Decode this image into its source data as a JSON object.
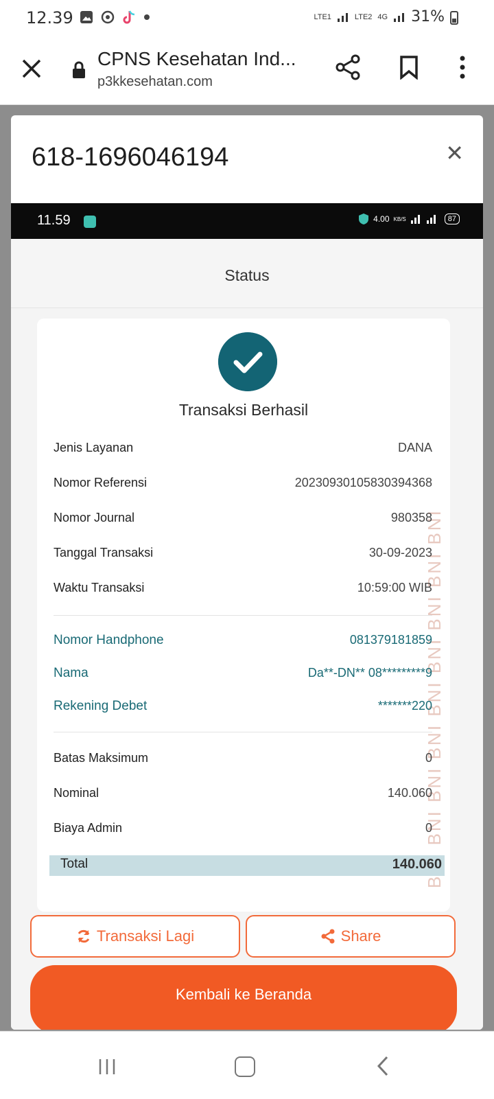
{
  "status_bar": {
    "time": "12.39",
    "battery": "31%",
    "network1": "LTE1",
    "network2": "LTE2",
    "network_type": "4G",
    "icons": [
      "image-icon",
      "sync-icon",
      "tiktok-icon",
      "dot-icon"
    ]
  },
  "browser": {
    "page_title": "CPNS Kesehatan Ind...",
    "domain": "p3kkesehatan.com"
  },
  "modal": {
    "title": "618-1696046194"
  },
  "inner_status_bar": {
    "time": "11.59",
    "speed": "4.00",
    "speed_unit": "KB/S",
    "battery": "87"
  },
  "receipt": {
    "header": "Status",
    "result": "Transaksi Berhasil",
    "rows": [
      {
        "label": "Jenis Layanan",
        "value": "DANA"
      },
      {
        "label": "Nomor Referensi",
        "value": "20230930105830394368"
      },
      {
        "label": "Nomor Journal",
        "value": "980358"
      },
      {
        "label": "Tanggal Transaksi",
        "value": "30-09-2023"
      },
      {
        "label": "Waktu Transaksi",
        "value": "10:59:00 WIB"
      }
    ],
    "customer": [
      {
        "label": "Nomor Handphone",
        "value": "081379181859"
      },
      {
        "label": "Nama",
        "value": "Da**-DN** 08*********9"
      },
      {
        "label": "Rekening Debet",
        "value": "*******220"
      }
    ],
    "amounts": [
      {
        "label": "Batas Maksimum",
        "value": "0"
      },
      {
        "label": "Nominal",
        "value": "140.060"
      },
      {
        "label": "Biaya Admin",
        "value": "0"
      }
    ],
    "total_label": "Total",
    "total_value": "140.060",
    "watermark": "BNI BNI BNI BNI BNI BNI BNI BNI BNI"
  },
  "buttons": {
    "repeat": "Transaksi Lagi",
    "share": "Share",
    "home": "Kembali ke Beranda"
  },
  "colors": {
    "accent": "#f15a24",
    "teal": "#136474"
  }
}
